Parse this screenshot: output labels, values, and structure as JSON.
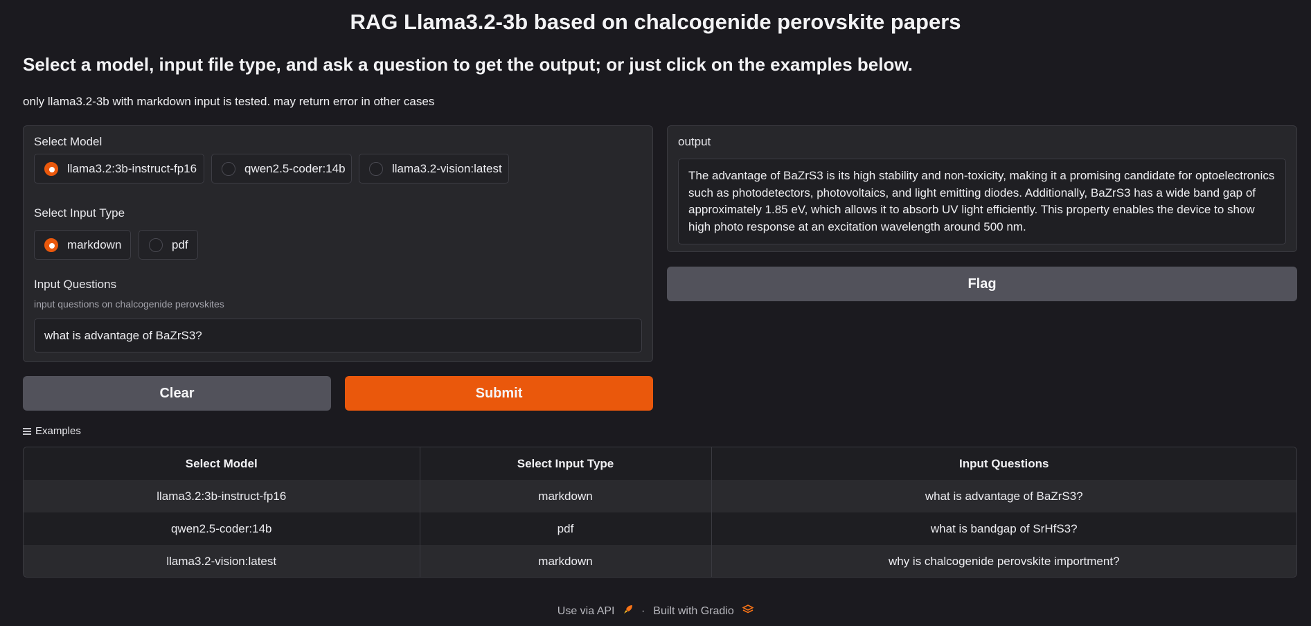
{
  "header": {
    "title": "RAG Llama3.2-3b based on chalcogenide perovskite papers",
    "subtitle": "Select a model, input file type, and ask a question to get the output; or just click on the examples below.",
    "note": "only llama3.2-3b with markdown input is tested. may return error in other cases"
  },
  "model_select": {
    "label": "Select Model",
    "options": [
      "llama3.2:3b-instruct-fp16",
      "qwen2.5-coder:14b",
      "llama3.2-vision:latest"
    ],
    "selected": "llama3.2:3b-instruct-fp16"
  },
  "input_type": {
    "label": "Select Input Type",
    "options": [
      "markdown",
      "pdf"
    ],
    "selected": "markdown"
  },
  "question": {
    "label": "Input Questions",
    "info": "input questions on chalcogenide perovskites",
    "value": "what is advantage of BaZrS3?"
  },
  "buttons": {
    "clear": "Clear",
    "submit": "Submit",
    "flag": "Flag"
  },
  "output": {
    "label": "output",
    "text": "The advantage of BaZrS3 is its high stability and non-toxicity, making it a promising candidate for optoelectronics such as photodetectors, photovoltaics, and light emitting diodes. Additionally, BaZrS3 has a wide band gap of approximately 1.85 eV, which allows it to absorb UV light efficiently. This property enables the device to show high photo response at an excitation wavelength around 500 nm."
  },
  "examples": {
    "label": "Examples",
    "headers": [
      "Select Model",
      "Select Input Type",
      "Input Questions"
    ],
    "rows": [
      [
        "llama3.2:3b-instruct-fp16",
        "markdown",
        "what is advantage of BaZrS3?"
      ],
      [
        "qwen2.5-coder:14b",
        "pdf",
        "what is bandgap of SrHfS3?"
      ],
      [
        "llama3.2-vision:latest",
        "markdown",
        "why is chalcogenide perovskite importment?"
      ]
    ]
  },
  "footer": {
    "api": "Use via API",
    "separator": "·",
    "built": "Built with Gradio"
  },
  "colors": {
    "accent": "#ea580c",
    "background": "#1b1a1f",
    "panel": "#27272b",
    "secondary_button": "#52525b"
  },
  "icons": {
    "api": "rocket-icon",
    "gradio": "gradio-logo-icon",
    "examples": "list-icon"
  }
}
